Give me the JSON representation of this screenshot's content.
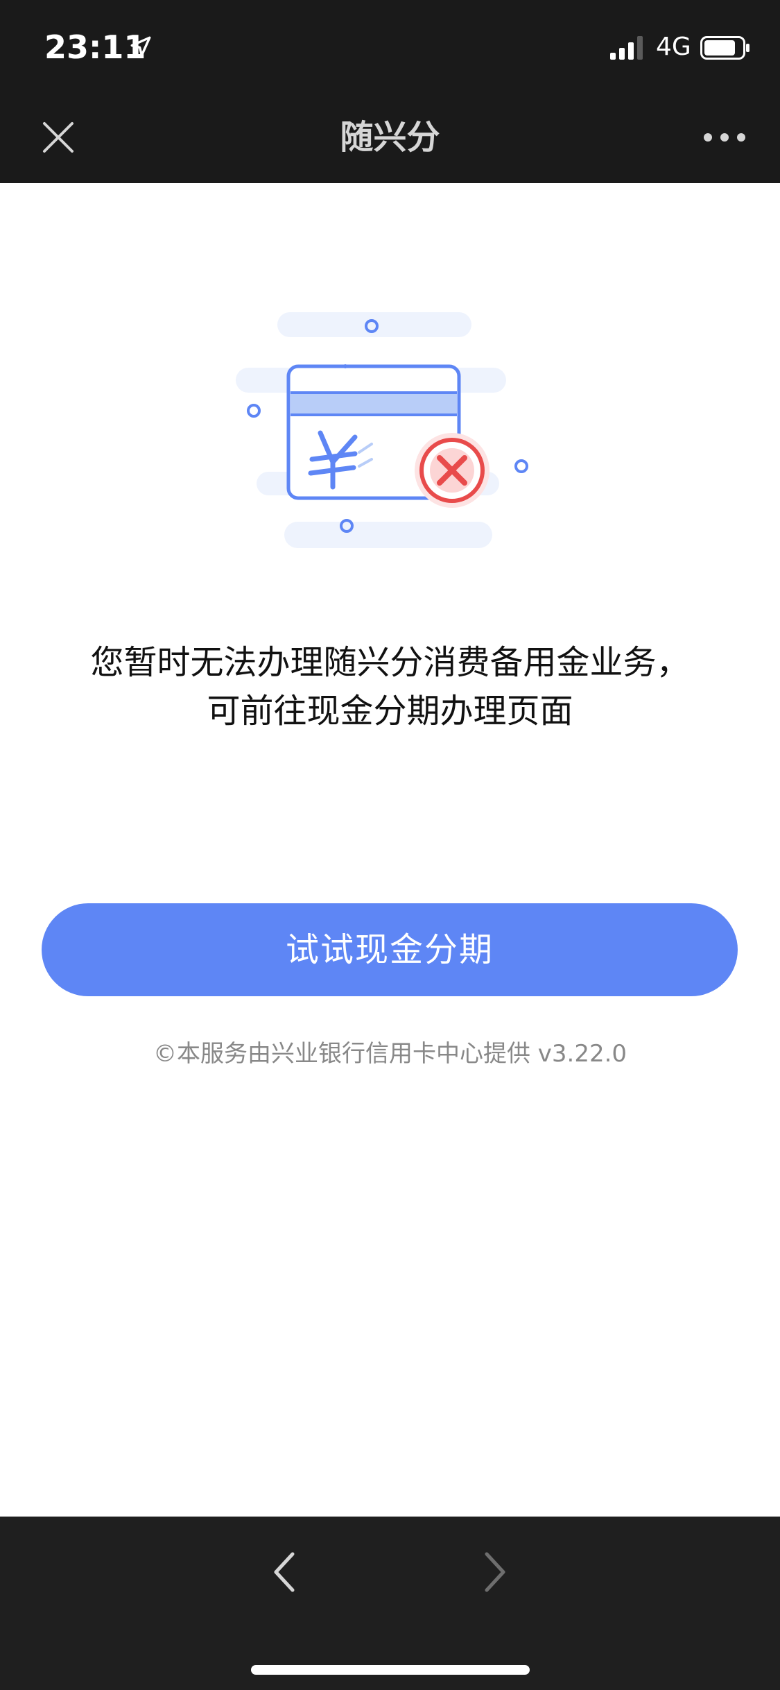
{
  "status_bar": {
    "time": "23:11",
    "network": "4G",
    "icons": [
      "location-arrow-icon",
      "signal-icon",
      "battery-icon"
    ]
  },
  "nav": {
    "title": "随兴分",
    "close_icon": "close-icon",
    "more_icon": "more-dots-icon"
  },
  "illustration": {
    "icon": "card-rejected-icon",
    "accent_color": "#5e86f5",
    "error_color": "#e84b4b"
  },
  "message": {
    "line1": "您暂时无法办理随兴分消费备用金业务，",
    "line2": "可前往现金分期办理页面"
  },
  "primary_button": {
    "label": "试试现金分期",
    "color": "#5e86f5"
  },
  "footer": {
    "note": "©本服务由兴业银行信用卡中心提供 v3.22.0"
  },
  "bottom_bar": {
    "back_icon": "chevron-left-icon",
    "forward_icon": "chevron-right-icon"
  }
}
